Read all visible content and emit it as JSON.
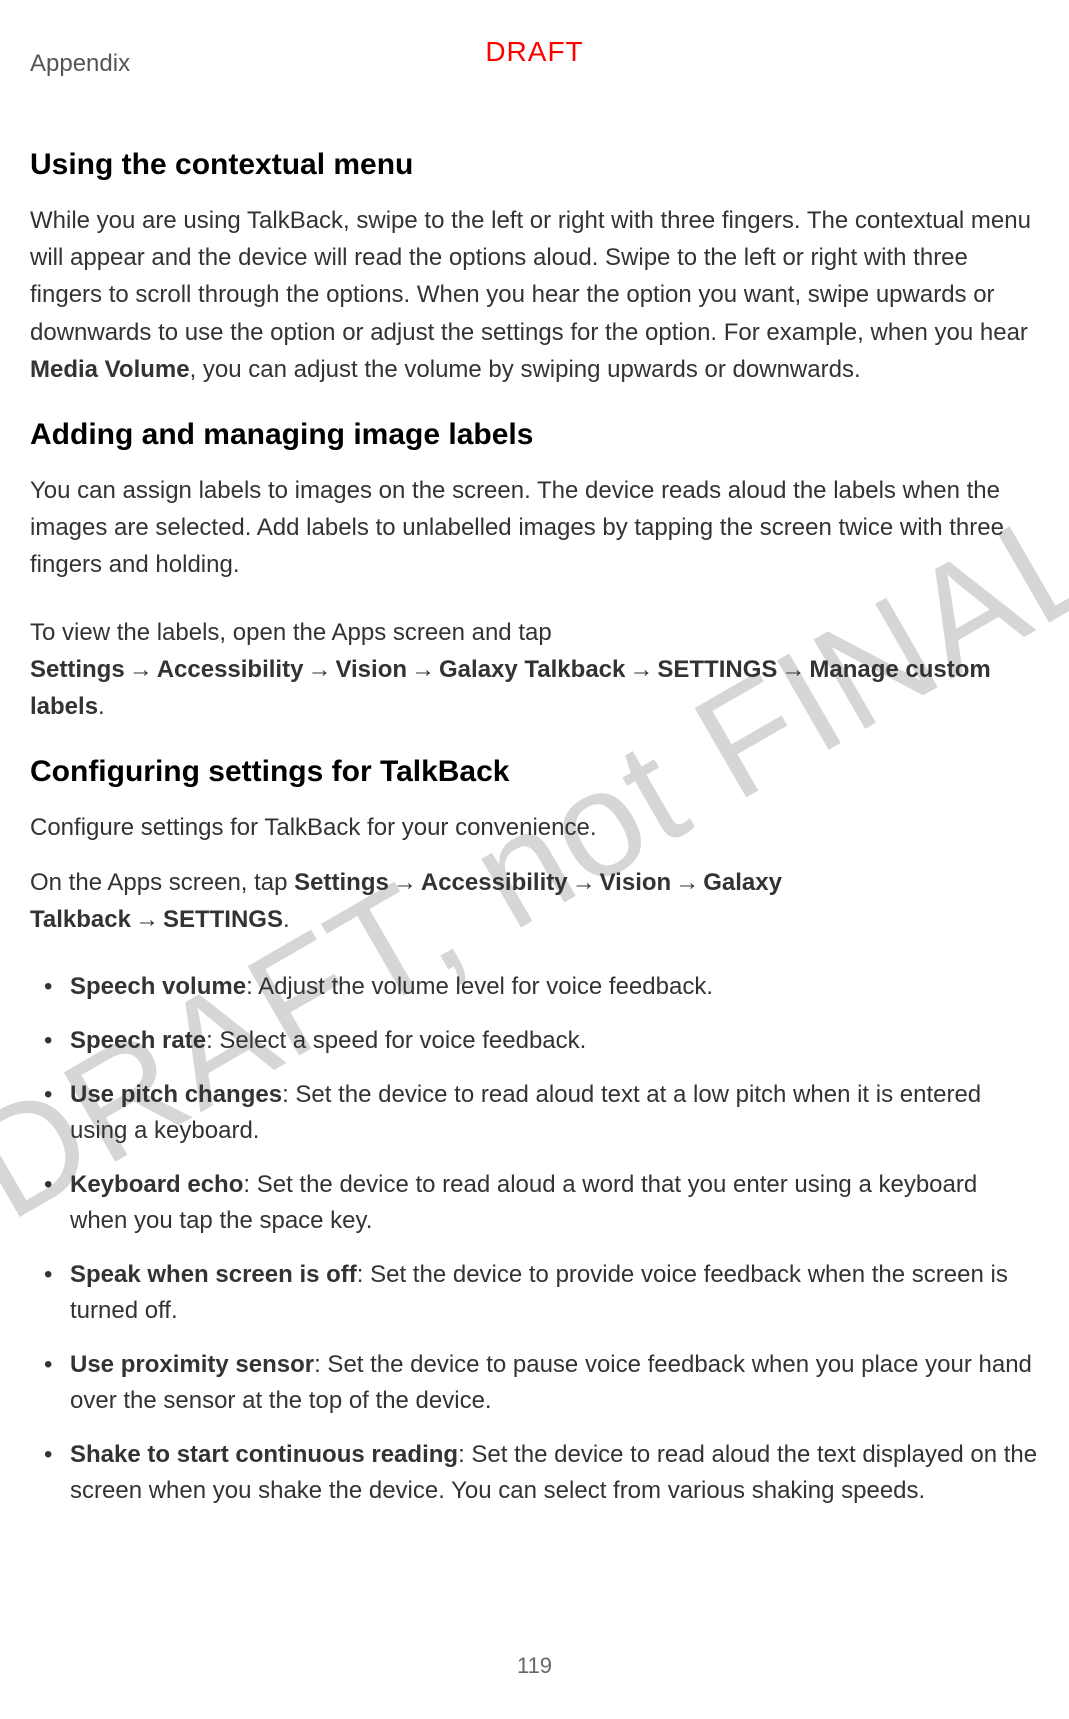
{
  "header": {
    "section": "Appendix",
    "draft_label": "DRAFT"
  },
  "watermark": "DRAFT, not FINAL",
  "page_number": "119",
  "s1": {
    "heading": "Using the contextual menu",
    "p1_a": "While you are using TalkBack, swipe to the left or right with three fingers. The contextual menu will appear and the device will read the options aloud. Swipe to the left or right with three fingers to scroll through the options. When you hear the option you want, swipe upwards or downwards to use the option or adjust the settings for the option. For example, when you hear ",
    "p1_bold": "Media Volume",
    "p1_b": ", you can adjust the volume by swiping upwards or downwards."
  },
  "s2": {
    "heading": "Adding and managing image labels",
    "p1": "You can assign labels to images on the screen. The device reads aloud the labels when the images are selected. Add labels to unlabelled images by tapping the screen twice with three fingers and holding.",
    "p2_a": "To view the labels, open the Apps screen and tap ",
    "nav1": "Settings",
    "nav2": "Accessibility",
    "nav3": "Vision",
    "nav4": "Galaxy Talkback",
    "nav5": "SETTINGS",
    "nav6": "Manage custom labels",
    "p2_b": "."
  },
  "s3": {
    "heading": "Configuring settings for TalkBack",
    "p1": "Configure settings for TalkBack for your convenience.",
    "p2_a": "On the Apps screen, tap ",
    "nav1": "Settings",
    "nav2": "Accessibility",
    "nav3": "Vision",
    "nav4": "Galaxy Talkback",
    "nav5": "SETTINGS",
    "p2_b": ".",
    "items": [
      {
        "term": "Speech volume",
        "desc": ": Adjust the volume level for voice feedback."
      },
      {
        "term": "Speech rate",
        "desc": ": Select a speed for voice feedback."
      },
      {
        "term": "Use pitch changes",
        "desc": ": Set the device to read aloud text at a low pitch when it is entered using a keyboard."
      },
      {
        "term": "Keyboard echo",
        "desc": ": Set the device to read aloud a word that you enter using a keyboard when you tap the space key."
      },
      {
        "term": "Speak when screen is off",
        "desc": ": Set the device to provide voice feedback when the screen is turned off."
      },
      {
        "term": "Use proximity sensor",
        "desc": ": Set the device to pause voice feedback when you place your hand over the sensor at the top of the device."
      },
      {
        "term": "Shake to start continuous reading",
        "desc": ": Set the device to read aloud the text displayed on the screen when you shake the device. You can select from various shaking speeds."
      }
    ]
  },
  "arrow": "→"
}
